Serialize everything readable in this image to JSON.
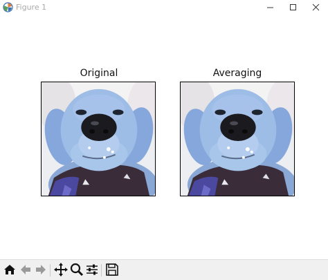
{
  "window": {
    "title": "Figure 1",
    "app_icon": "matplotlib-icon",
    "controls": [
      "minimize-icon",
      "maximize-icon",
      "close-icon"
    ]
  },
  "figure": {
    "subplots": [
      {
        "title": "Original",
        "image": "dog-photo"
      },
      {
        "title": "Averaging",
        "image": "dog-photo"
      }
    ]
  },
  "toolbar": {
    "buttons": [
      {
        "icon": "home-icon",
        "enabled": true
      },
      {
        "icon": "back-arrow-icon",
        "enabled": false
      },
      {
        "icon": "forward-arrow-icon",
        "enabled": false
      },
      {
        "icon": "pan-icon",
        "enabled": true
      },
      {
        "icon": "zoom-icon",
        "enabled": true
      },
      {
        "icon": "configure-subplots-icon",
        "enabled": true
      },
      {
        "icon": "save-icon",
        "enabled": true
      }
    ]
  },
  "colors": {
    "title_text": "#a9a9a9",
    "toolbar_bg": "#f0f0f0",
    "fur": "#98b8e0",
    "scarf": "#3a2a3a"
  }
}
